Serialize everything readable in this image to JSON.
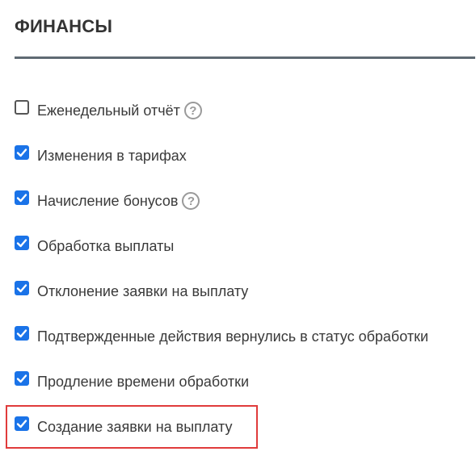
{
  "section": {
    "title": "ФИНАНСЫ"
  },
  "options": [
    {
      "label": "Еженедельный отчёт",
      "checked": false,
      "help": true
    },
    {
      "label": "Изменения в тарифах",
      "checked": true,
      "help": false
    },
    {
      "label": "Начисление бонусов",
      "checked": true,
      "help": true
    },
    {
      "label": "Обработка выплаты",
      "checked": true,
      "help": false
    },
    {
      "label": "Отклонение заявки на выплату",
      "checked": true,
      "help": false
    },
    {
      "label": "Подтвержденные действия вернулись в статус обработки",
      "checked": true,
      "help": false
    },
    {
      "label": "Продление времени обработки",
      "checked": true,
      "help": false
    },
    {
      "label": "Создание заявки на выплату",
      "checked": true,
      "help": false
    }
  ],
  "help_icon": {
    "glyph": "?",
    "icon": "question-circle-icon"
  },
  "colors": {
    "checkbox_checked": "#1a73e8",
    "highlight_border": "#e03b3b",
    "divider": "#5f6a73"
  }
}
